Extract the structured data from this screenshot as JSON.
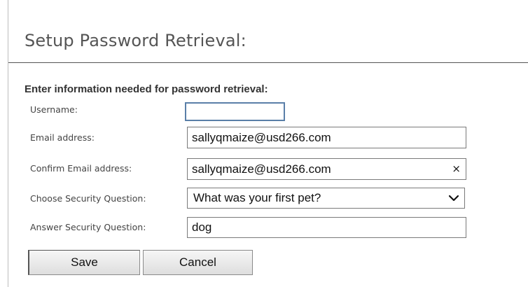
{
  "page": {
    "title": "Setup Password Retrieval:",
    "section_heading": "Enter information needed for password retrieval:"
  },
  "form": {
    "username": {
      "label": "Username:",
      "value": ""
    },
    "email": {
      "label": "Email address:",
      "value": "sallyqmaize@usd266.com"
    },
    "confirm_email": {
      "label": "Confirm Email address:",
      "value": "sallyqmaize@usd266.com",
      "clear_glyph": "×"
    },
    "security_question": {
      "label": "Choose Security Question:",
      "selected": "What was your first pet?"
    },
    "security_answer": {
      "label": "Answer Security Question:",
      "value": "dog"
    }
  },
  "buttons": {
    "save_label": "Save",
    "cancel_label": "Cancel"
  },
  "icons": {
    "clear": "close-icon",
    "dropdown": "chevron-down-icon"
  },
  "colors": {
    "focus_border": "#5a7fa8",
    "title_text": "#555555"
  }
}
